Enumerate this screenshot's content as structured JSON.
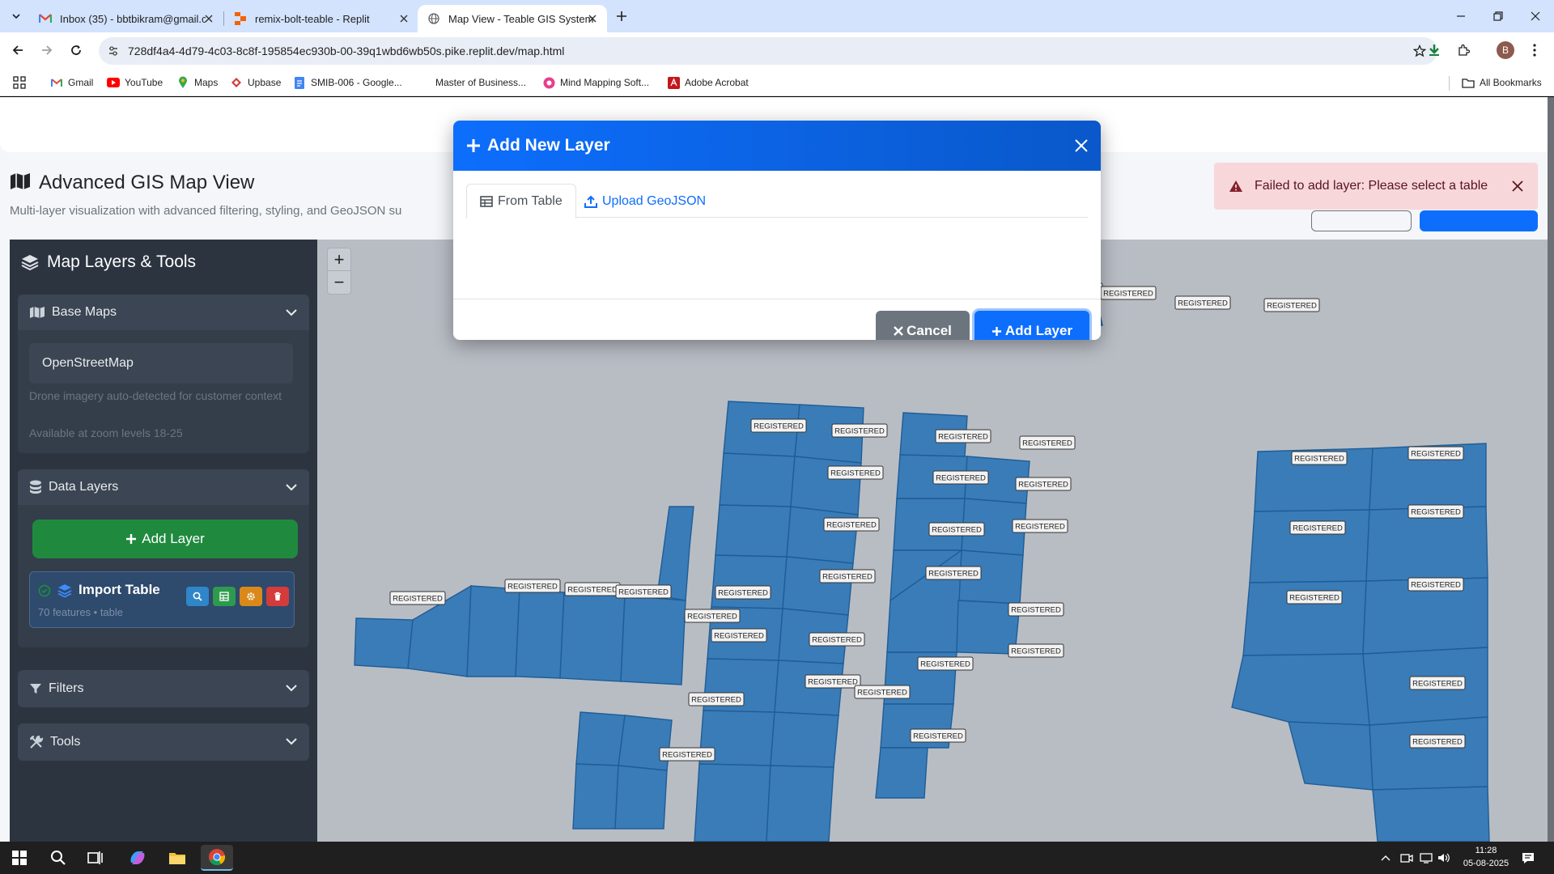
{
  "browser": {
    "tabs": [
      {
        "title": "Inbox (35) - bbtbikram@gmail.c",
        "icon": "gmail-icon"
      },
      {
        "title": "remix-bolt-teable - Replit",
        "icon": "replit-icon"
      },
      {
        "title": "Map View - Teable GIS System",
        "icon": "globe-icon",
        "active": true
      }
    ],
    "url": "728df4a4-4d79-4c03-8c8f-195854ec930b-00-39q1wbd6wb50s.pike.replit.dev/map.html",
    "profile_initial": "B",
    "bookmarks": [
      "Gmail",
      "YouTube",
      "Maps",
      "Upbase",
      "SMIB-006 - Google...",
      "Master of Business...",
      "Mind Mapping Soft...",
      "Adobe Acrobat"
    ],
    "all_bookmarks": "All Bookmarks"
  },
  "page": {
    "title": "Advanced GIS Map View",
    "subtitle": "Multi-layer visualization with advanced filtering, styling, and GeoJSON su"
  },
  "sidebar": {
    "title": "Map Layers & Tools",
    "base_maps": {
      "header": "Base Maps",
      "selected": "OpenStreetMap",
      "note1": "Drone imagery auto-detected for customer context",
      "note2": "Available at zoom levels 18-25"
    },
    "data_layers": {
      "header": "Data Layers",
      "add_button": "Add Layer",
      "layer": {
        "name": "Import Table",
        "meta": "70 features • table"
      }
    },
    "filters": {
      "header": "Filters"
    },
    "tools": {
      "header": "Tools"
    }
  },
  "map": {
    "zoom_in": "+",
    "zoom_out": "−",
    "parcel_label": "REGISTERED",
    "colors": {
      "parcel_fill": "#3a7cb8",
      "parcel_stroke": "#1f5d96",
      "map_bg": "#b8bdc4"
    }
  },
  "modal": {
    "title": "Add New Layer",
    "tab_table": "From Table",
    "tab_geojson": "Upload GeoJSON",
    "cancel": "Cancel",
    "add": "Add Layer"
  },
  "toast": {
    "message": "Failed to add layer: Please select a table"
  },
  "taskbar": {
    "time": "11:28",
    "date": "05-08-2025"
  }
}
